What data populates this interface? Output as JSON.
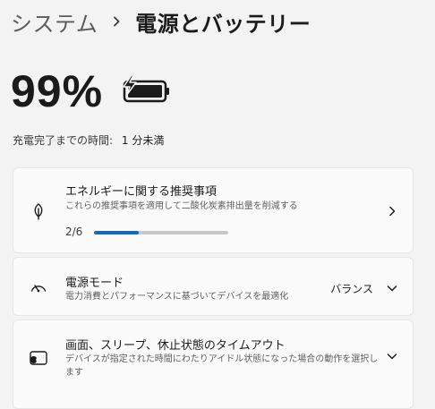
{
  "breadcrumb": {
    "parent": "システム",
    "current": "電源とバッテリー"
  },
  "battery": {
    "percent_text": "99%",
    "charging": true,
    "level": 0.99
  },
  "charge": {
    "label": "充電完了までの時間:",
    "value": "1 分未満"
  },
  "cards": {
    "eco": {
      "icon": "leaf-icon",
      "title": "エネルギーに関する推奨事項",
      "description": "これらの推奨事項を適用して二酸化炭素排出量を削減する",
      "progress_text": "2/6",
      "progress_fraction": 0.333
    },
    "power_mode": {
      "icon": "gauge-icon",
      "title": "電源モード",
      "description": "電力消費とパフォーマンスに基づいてデバイスを最適化",
      "value": "バランス"
    },
    "screen_sleep": {
      "icon": "screen-sleep-icon",
      "title": "画面、スリープ、休止状態のタイムアウト",
      "description": "デバイスが指定された時間にわたりアイドル状態になった場合の動作を選択します"
    }
  },
  "colors": {
    "background": "#f3f3f3",
    "card": "#fbfbfb",
    "accent": "#0f6cbd",
    "track": "#c8c8c8"
  }
}
